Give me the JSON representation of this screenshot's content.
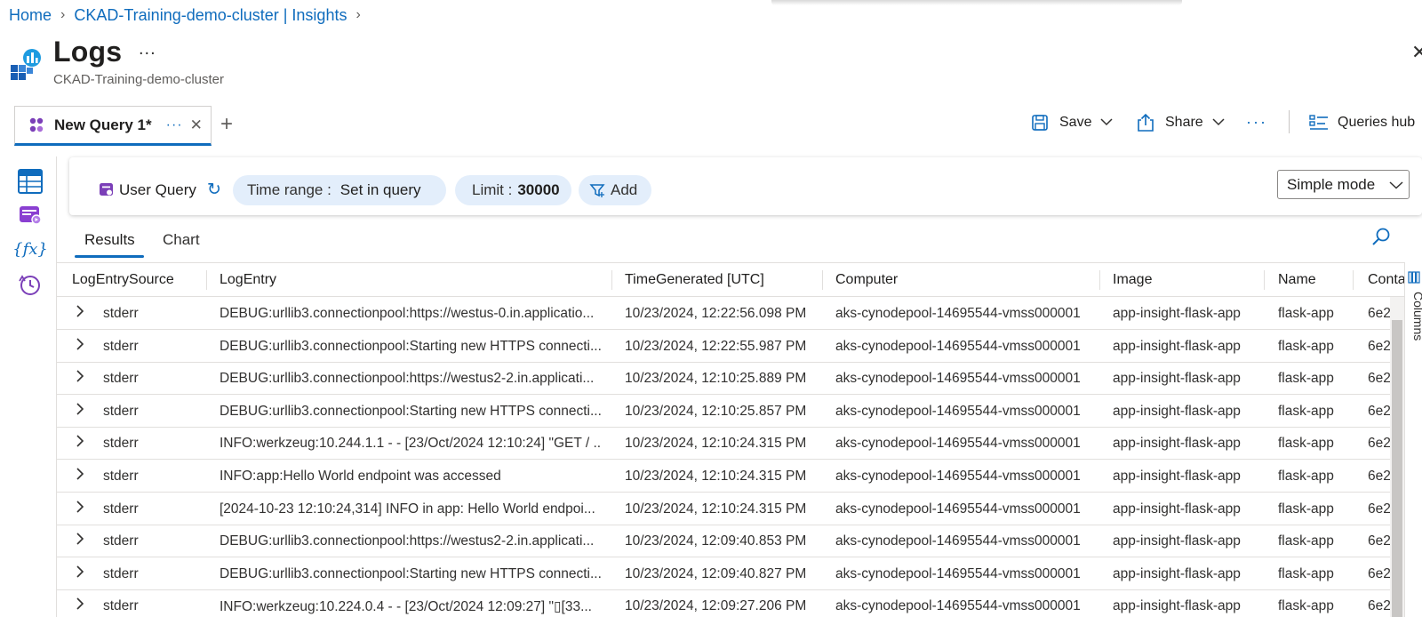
{
  "breadcrumb": {
    "home": "Home",
    "parent": "CKAD-Training-demo-cluster | Insights",
    "sep": ">"
  },
  "header": {
    "title": "Logs",
    "more": "...",
    "subtitle": "CKAD-Training-demo-cluster",
    "close": "✕"
  },
  "query_tab": {
    "label": "New Query 1*",
    "more": "···",
    "close": "✕",
    "add": "+"
  },
  "toolbar": {
    "save": "Save",
    "share": "Share",
    "more": "···",
    "queries_hub": "Queries hub"
  },
  "filters": {
    "user_query": "User Query",
    "time_range_label": "Time range :",
    "time_range_value": "Set in query",
    "limit_label": "Limit :",
    "limit_value": "30000",
    "add": "Add",
    "mode": "Simple mode"
  },
  "results_tabs": [
    "Results",
    "Chart"
  ],
  "columns_panel_label": "Columns",
  "table": {
    "columns": [
      "LogEntrySource",
      "LogEntry",
      "TimeGenerated [UTC]",
      "Computer",
      "Image",
      "Name",
      "Conta"
    ],
    "rows": [
      [
        "stderr",
        "DEBUG:urllib3.connectionpool:https://westus-0.in.applicatio...",
        "10/23/2024, 12:22:56.098 PM",
        "aks-cynodepool-14695544-vmss000001",
        "app-insight-flask-app",
        "flask-app",
        "6e2"
      ],
      [
        "stderr",
        "DEBUG:urllib3.connectionpool:Starting new HTTPS connecti...",
        "10/23/2024, 12:22:55.987 PM",
        "aks-cynodepool-14695544-vmss000001",
        "app-insight-flask-app",
        "flask-app",
        "6e2"
      ],
      [
        "stderr",
        "DEBUG:urllib3.connectionpool:https://westus2-2.in.applicati...",
        "10/23/2024, 12:10:25.889 PM",
        "aks-cynodepool-14695544-vmss000001",
        "app-insight-flask-app",
        "flask-app",
        "6e2"
      ],
      [
        "stderr",
        "DEBUG:urllib3.connectionpool:Starting new HTTPS connecti...",
        "10/23/2024, 12:10:25.857 PM",
        "aks-cynodepool-14695544-vmss000001",
        "app-insight-flask-app",
        "flask-app",
        "6e2"
      ],
      [
        "stderr",
        "INFO:werkzeug:10.244.1.1 - - [23/Oct/2024 12:10:24] \"GET / ...",
        "10/23/2024, 12:10:24.315 PM",
        "aks-cynodepool-14695544-vmss000001",
        "app-insight-flask-app",
        "flask-app",
        "6e2"
      ],
      [
        "stderr",
        "INFO:app:Hello World endpoint was accessed",
        "10/23/2024, 12:10:24.315 PM",
        "aks-cynodepool-14695544-vmss000001",
        "app-insight-flask-app",
        "flask-app",
        "6e2"
      ],
      [
        "stderr",
        "[2024-10-23 12:10:24,314] INFO in app: Hello World endpoi...",
        "10/23/2024, 12:10:24.315 PM",
        "aks-cynodepool-14695544-vmss000001",
        "app-insight-flask-app",
        "flask-app",
        "6e2"
      ],
      [
        "stderr",
        "DEBUG:urllib3.connectionpool:https://westus2-2.in.applicati...",
        "10/23/2024, 12:09:40.853 PM",
        "aks-cynodepool-14695544-vmss000001",
        "app-insight-flask-app",
        "flask-app",
        "6e2"
      ],
      [
        "stderr",
        "DEBUG:urllib3.connectionpool:Starting new HTTPS connecti...",
        "10/23/2024, 12:09:40.827 PM",
        "aks-cynodepool-14695544-vmss000001",
        "app-insight-flask-app",
        "flask-app",
        "6e2"
      ],
      [
        "stderr",
        "INFO:werkzeug:10.224.0.4 - - [23/Oct/2024 12:09:27] \"▯[33...",
        "10/23/2024, 12:09:27.206 PM",
        "aks-cynodepool-14695544-vmss000001",
        "app-insight-flask-app",
        "flask-app",
        "6e2"
      ]
    ]
  },
  "colors": {
    "accent": "#0f6cbd",
    "pill_bg": "#e3eefb",
    "border": "#e1dfdd"
  },
  "icons": {
    "logo": "log-analytics-logo-icon",
    "query_tab": "query-icon",
    "save": "save-icon",
    "share": "share-icon",
    "queries_hub": "queries-hub-icon",
    "rail": [
      "tables-icon",
      "queries-icon",
      "functions-icon",
      "history-icon"
    ],
    "user_query": "user-query-icon",
    "refresh": "refresh-icon",
    "filter": "filter-icon",
    "search": "search-icon",
    "columns": "columns-icon"
  }
}
